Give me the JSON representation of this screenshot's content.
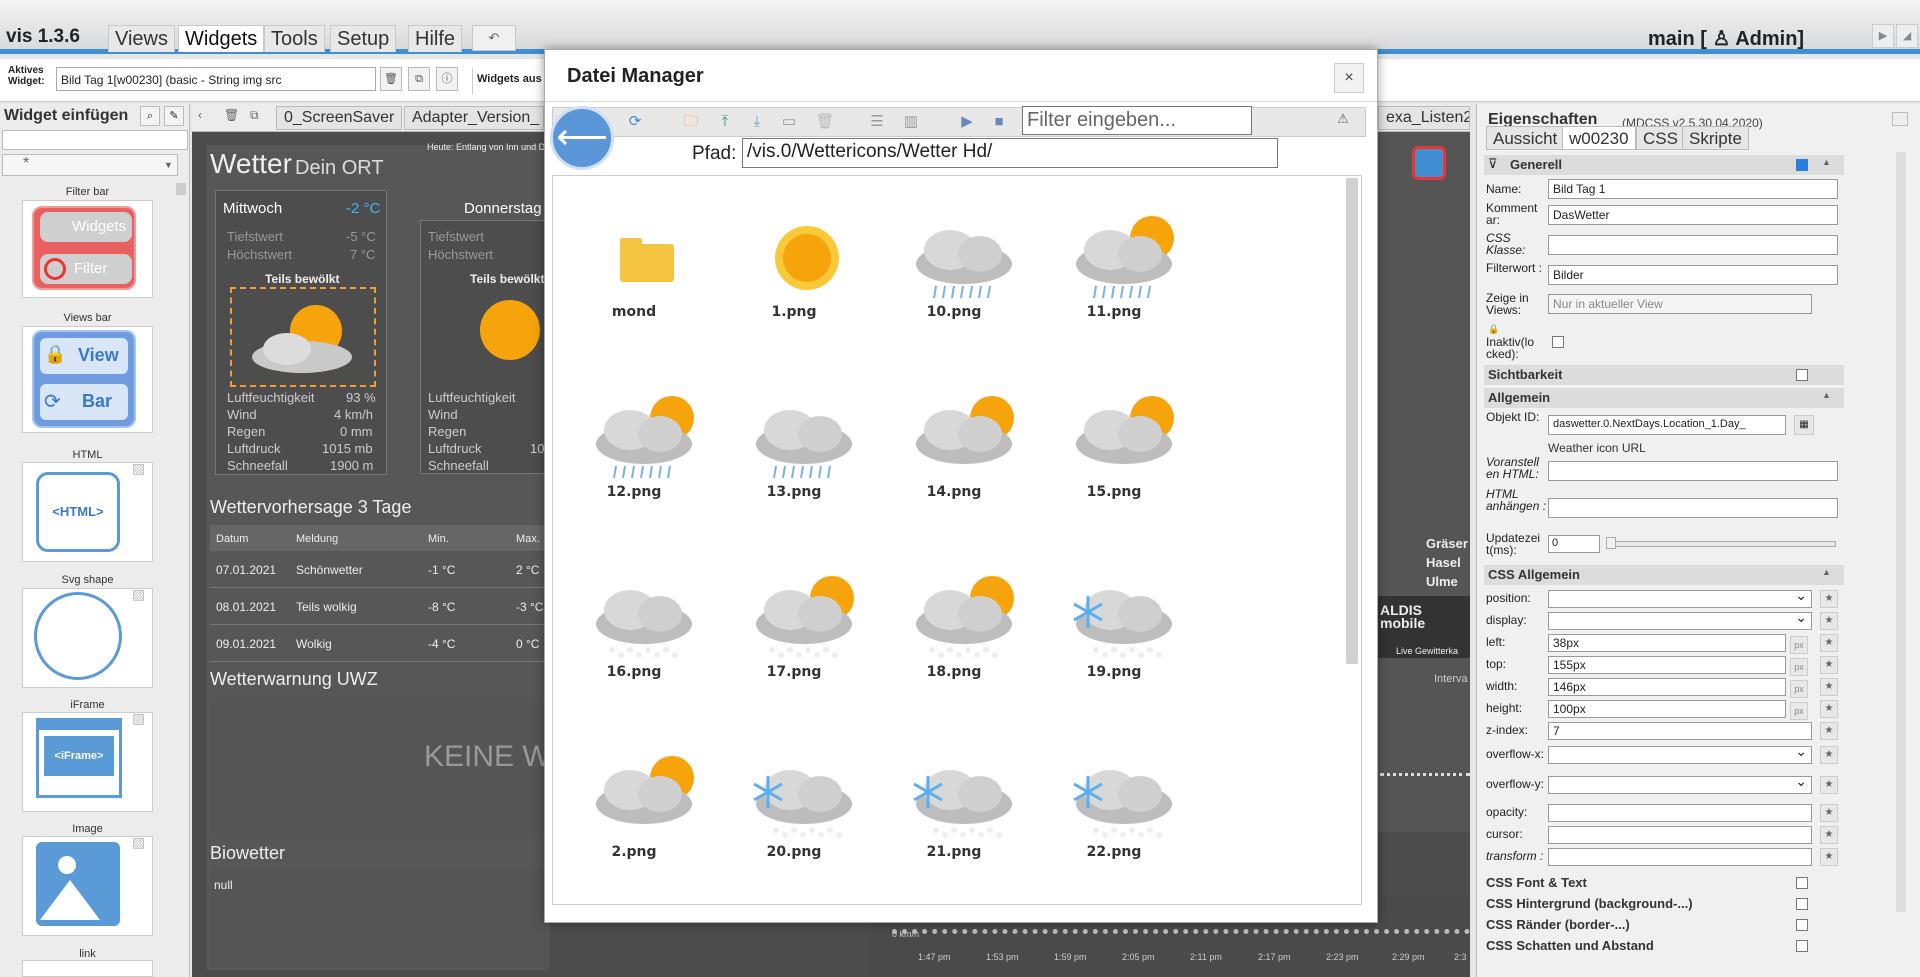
{
  "app": {
    "title": "vis 1.3.6",
    "menu": [
      "Views",
      "Widgets",
      "Tools",
      "Setup",
      "Hilfe"
    ],
    "active_menu": "Widgets",
    "undo": "↶",
    "view_user": "main [ ♙ Admin]"
  },
  "toolbar": {
    "active_label": "Aktives Widget:",
    "active_widget": "Bild Tag 1[w00230] (basic - String img src",
    "widgets_aus": "Widgets aus"
  },
  "palette": {
    "title": "Widget einfügen",
    "filter_value": "*",
    "items": [
      {
        "title": "Filter bar",
        "b1": "Widgets",
        "b2": "Filter"
      },
      {
        "title": "Views bar",
        "b1": "View",
        "b2": "Bar"
      },
      {
        "title": "HTML",
        "inner": "<HTML>"
      },
      {
        "title": "Svg shape"
      },
      {
        "title": "iFrame",
        "inner": "<iFrame>"
      },
      {
        "title": "Image"
      },
      {
        "title": "link"
      }
    ]
  },
  "canvas": {
    "tabs": [
      "0_ScreenSaver",
      "Adapter_Version_",
      "exa_Listen2"
    ],
    "wetter": {
      "title": "Wetter",
      "subtitle": "Dein ORT",
      "note": "Heute: Entlang von Inn und Do",
      "days": [
        {
          "name": "Mittwoch",
          "temp": "-2 °C",
          "tiefst_label": "Tiefstwert",
          "tiefst": "-5 °C",
          "hoechst_label": "Höchstwert",
          "hoechst": "7 °C",
          "cond": "Teils bewölkt",
          "rows": [
            [
              "Luftfeuchtigkeit",
              "93 %"
            ],
            [
              "Wind",
              "4 km/h"
            ],
            [
              "Regen",
              "0 mm"
            ],
            [
              "Luftdruck",
              "1015 mb"
            ],
            [
              "Schneefall",
              "1900 m"
            ]
          ]
        },
        {
          "name": "Donnerstag",
          "tiefst_label": "Tiefstwert",
          "hoechst_label": "Höchstwert",
          "cond": "Teils bewölkt",
          "rows": [
            [
              "Luftfeuchtigkeit",
              ""
            ],
            [
              "Wind",
              ""
            ],
            [
              "Regen",
              ""
            ],
            [
              "Luftdruck",
              "10"
            ],
            [
              "Schneefall",
              ""
            ]
          ]
        }
      ],
      "forecast_title": "Wettervorhersage 3 Tage",
      "forecast_cols": [
        "Datum",
        "Meldung",
        "Min.",
        "Max."
      ],
      "forecast_rows": [
        [
          "07.01.2021",
          "Schönwetter",
          "-1 °C",
          "2 °C"
        ],
        [
          "08.01.2021",
          "Teils wolkig",
          "-8 °C",
          "-3 °C"
        ],
        [
          "09.01.2021",
          "Wolkig",
          "-4 °C",
          "0 °C"
        ]
      ],
      "uwz_title": "Wetterwarnung UWZ",
      "uwz_text": "KEINE WA",
      "bio_title": "Biowetter",
      "bio_value": "null"
    },
    "right_labels": [
      "Gräser",
      "Hasel",
      "Ulme"
    ],
    "aldi": "ALDIS mobile",
    "live": "Live Gewitterka",
    "interval": "Interva",
    "speed": "0 km/h",
    "times": [
      "1:47 pm",
      "1:53 pm",
      "1:59 pm",
      "2:05 pm",
      "2:11 pm",
      "2:17 pm",
      "2:23 pm",
      "2:29 pm",
      "2:3"
    ]
  },
  "props": {
    "title": "Eigenschaften",
    "version": "(MDCSS v2.5.30 04.2020)",
    "tabs": [
      "Aussicht",
      "w00230",
      "CSS",
      "Skripte"
    ],
    "generell": "Generell",
    "name_label": "Name:",
    "name": "Bild Tag 1",
    "komm_label": "Komment ar:",
    "komm": "DasWetter",
    "cssk_label": "CSS Klasse:",
    "filter_label": "Filterwort :",
    "filter": "Bilder",
    "zeige_label": "Zeige in Views:",
    "zeige": "Nur in aktueller View",
    "inaktiv_label": "Inaktiv(lo cked):",
    "sicht": "Sichtbarkeit",
    "allgemein": "Allgemein",
    "objekt_label": "Objekt ID:",
    "objekt": "daswetter.0.NextDays.Location_1.Day_",
    "weather_url": "Weather icon URL",
    "voran_label": "Voranstell en HTML:",
    "anh_label": "HTML anhängen :",
    "upd_label": "Updatezei t(ms):",
    "upd": "0",
    "css_allg": "CSS Allgemein",
    "css_rows": [
      {
        "label": "position:",
        "type": "select",
        "value": ""
      },
      {
        "label": "display:",
        "type": "select",
        "value": ""
      },
      {
        "label": "left:",
        "type": "input",
        "value": "38px",
        "px": true
      },
      {
        "label": "top:",
        "type": "input",
        "value": "155px",
        "px": true
      },
      {
        "label": "width:",
        "type": "input",
        "value": "146px",
        "px": true
      },
      {
        "label": "height:",
        "type": "input",
        "value": "100px",
        "px": true
      },
      {
        "label": "z-index:",
        "type": "input",
        "value": "7"
      },
      {
        "label": "overflow-x:",
        "type": "select",
        "value": ""
      },
      {
        "label": "overflow-y:",
        "type": "select",
        "value": ""
      },
      {
        "label": "opacity:",
        "type": "input",
        "value": ""
      },
      {
        "label": "cursor:",
        "type": "input",
        "value": ""
      },
      {
        "label": "transform :",
        "type": "input",
        "value": ""
      }
    ],
    "groups": [
      "CSS Font & Text",
      "CSS Hintergrund (background-...)",
      "CSS Ränder (border-...)",
      "CSS Schatten und Abstand"
    ]
  },
  "modal": {
    "title": "Datei Manager",
    "close": "×",
    "filter_placeholder": "Filter eingeben...",
    "pfad_label": "Pfad:",
    "pfad": "/vis.0/Wettericons/Wetter Hd/",
    "files": [
      {
        "name": "mond",
        "icon": "folder-icon"
      },
      {
        "name": "1.png",
        "icon": "sun-icon"
      },
      {
        "name": "10.png",
        "icon": "rain-cloud-icon"
      },
      {
        "name": "11.png",
        "icon": "sun-rain-cloud-icon"
      },
      {
        "name": "12.png",
        "icon": "sun-rain-cloud-icon"
      },
      {
        "name": "13.png",
        "icon": "rain-cloud-icon"
      },
      {
        "name": "14.png",
        "icon": "sun-cloud-icon"
      },
      {
        "name": "15.png",
        "icon": "sun-cloud-icon"
      },
      {
        "name": "16.png",
        "icon": "snow-cloud-icon"
      },
      {
        "name": "17.png",
        "icon": "sun-snow-cloud-icon"
      },
      {
        "name": "18.png",
        "icon": "sun-snow-cloud-icon"
      },
      {
        "name": "19.png",
        "icon": "snowflake-cloud-icon"
      },
      {
        "name": "2.png",
        "icon": "sun-cloud-icon"
      },
      {
        "name": "20.png",
        "icon": "snowflake-cloud-icon"
      },
      {
        "name": "21.png",
        "icon": "snowflake-cloud-icon"
      },
      {
        "name": "22.png",
        "icon": "snowflake-cloud-icon"
      }
    ]
  },
  "colors": {
    "accent": "#3f8fd2",
    "sun": "#f7a40c",
    "folder": "#f5c542",
    "canvas": "#4c4c4c"
  }
}
